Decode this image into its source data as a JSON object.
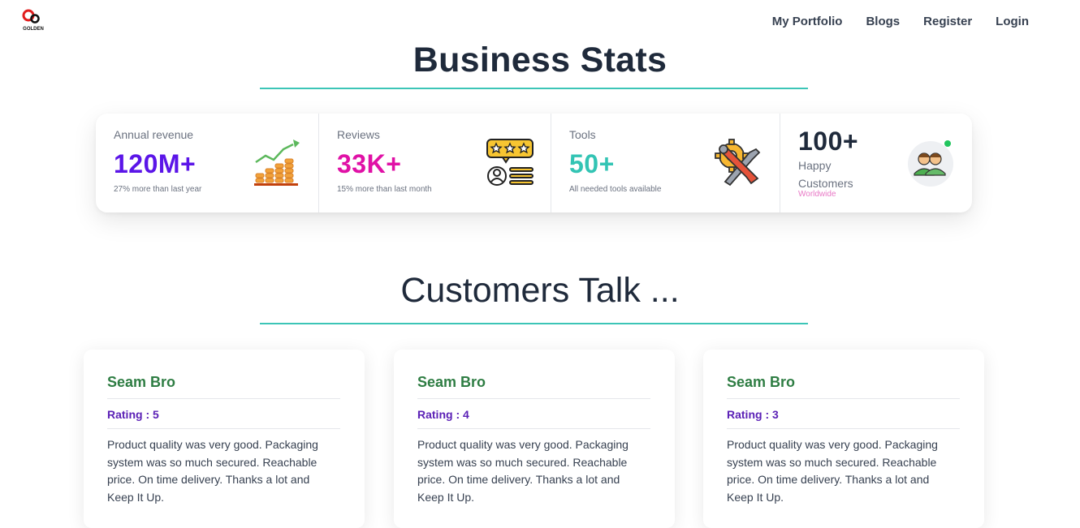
{
  "brand": {
    "logo_text": "GOLDEN"
  },
  "nav": {
    "items": [
      "My Portfolio",
      "Blogs",
      "Register",
      "Login"
    ]
  },
  "business": {
    "title": "Business Stats",
    "stats": [
      {
        "label": "Annual revenue",
        "value": "120M+",
        "desc": "27% more than last year",
        "color": "#5b15e8",
        "icon": "revenue-growth-icon"
      },
      {
        "label": "Reviews",
        "value": "33K+",
        "desc": "15% more than last month",
        "color": "#e011a6",
        "icon": "rating-review-icon"
      },
      {
        "label": "Tools",
        "value": "50+",
        "desc": "All needed tools available",
        "color": "#33c4b4",
        "icon": "tools-gear-icon"
      },
      {
        "label": "Happy Customers",
        "value": "100+",
        "desc": "Worldwide",
        "color": "#1f2a3b",
        "icon": "customers-avatar-icon"
      }
    ]
  },
  "testimonials": {
    "title": "Customers Talk ...",
    "cards": [
      {
        "name": "Seam Bro",
        "rating": "Rating : 5",
        "text": "Product quality was very good. Packaging system was so much secured. Reachable price. On time delivery. Thanks a lot and Keep It Up."
      },
      {
        "name": "Seam Bro",
        "rating": "Rating : 4",
        "text": "Product quality was very good. Packaging system was so much secured. Reachable price. On time delivery. Thanks a lot and Keep It Up."
      },
      {
        "name": "Seam Bro",
        "rating": "Rating : 3",
        "text": "Product quality was very good. Packaging system was so much secured. Reachable price. On time delivery. Thanks a lot and Keep It Up."
      }
    ]
  },
  "colors": {
    "accent_line": "#3cc5b7",
    "reviewer_name": "#2e7d43",
    "rating": "#5b21b6"
  }
}
